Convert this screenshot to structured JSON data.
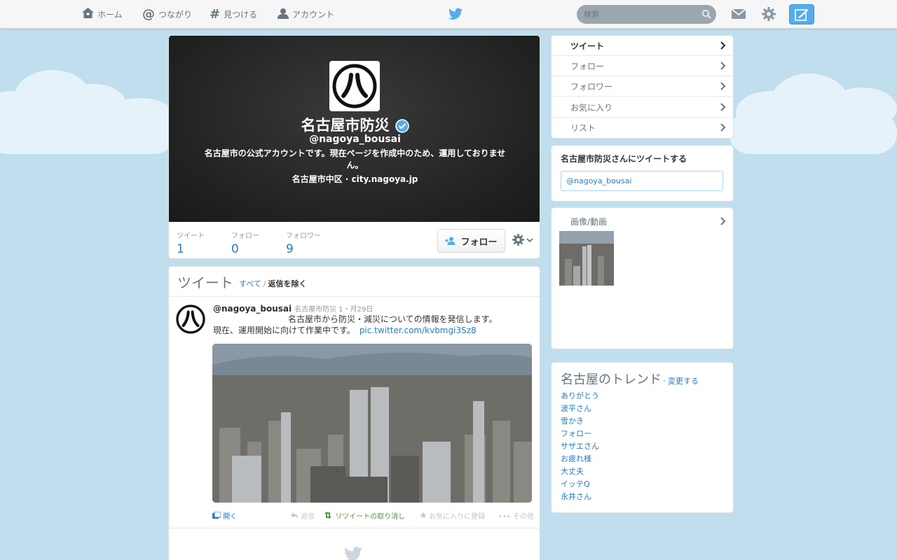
{
  "nav": {
    "home": "ホーム",
    "connect": "つながり",
    "discover": "見つける",
    "account": "アカウント",
    "search_placeholder": "検索"
  },
  "profile": {
    "name": "名古屋市防災",
    "handle": "@nagoya_bousai",
    "bio": "名古屋市の公式アカウントです。現在ページを作成中のため、運用しておりません。",
    "location": "名古屋市中区 · city.nagoya.jp",
    "avatar_char": "八",
    "stats": [
      {
        "label": "ツイート",
        "value": "1"
      },
      {
        "label": "フォロー",
        "value": "0"
      },
      {
        "label": "フォロワー",
        "value": "9"
      }
    ],
    "follow_label": "フォロー"
  },
  "timeline": {
    "title": "ツイート",
    "filter_all": "すべて",
    "filter_sep": "/",
    "filter_no_replies": "返信を除く",
    "tweet": {
      "handle": "@nagoya_bousai",
      "meta": "名古屋市防災 1・月29日",
      "text1": "名古屋市から防災・減災についての情報を発信します。",
      "text2": "現在、運用開始に向けて作業中です。",
      "link": "pic.twitter.com/kvbmgi3Sz8",
      "actions": {
        "open": "開く",
        "reply": "返信",
        "retweet": "リツイートの取り消し",
        "favorite": "お気に入りに登録",
        "more": "その他"
      }
    }
  },
  "sidebar": {
    "nav_items": [
      "ツイート",
      "フォロー",
      "フォロワー",
      "お気に入り",
      "リスト"
    ],
    "tweet_to_title": "名古屋市防災さんにツイートする",
    "tweet_to_value": "@nagoya_bousai",
    "media_title": "画像/動画",
    "trends_title": "名古屋のトレンド",
    "trends_change": "· 変更する",
    "trends": [
      "ありがとう",
      "波平さん",
      "雪かき",
      "フォロー",
      "サザエさん",
      "お疲れ様",
      "大丈夫",
      "イッテQ",
      "永井さん"
    ]
  },
  "colors": {
    "accent": "#55acee",
    "link": "#2a7bbf",
    "retweet": "#5c913b",
    "sky": "#c0deed"
  }
}
